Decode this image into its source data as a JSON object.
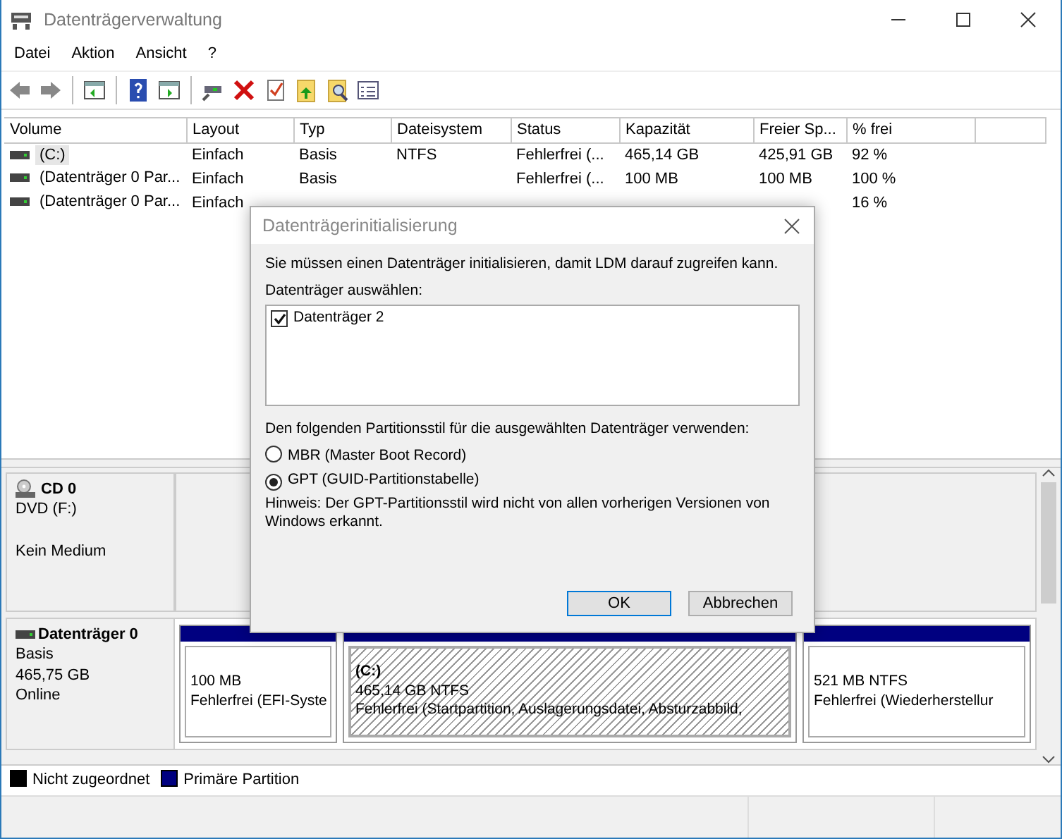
{
  "window": {
    "title": "Datenträgerverwaltung"
  },
  "menu": [
    "Datei",
    "Aktion",
    "Ansicht",
    "?"
  ],
  "volumes_table": {
    "columns": [
      "Volume",
      "Layout",
      "Typ",
      "Dateisystem",
      "Status",
      "Kapazität",
      "Freier Sp...",
      "% frei"
    ],
    "rows": [
      {
        "selected": true,
        "cells": [
          "(C:)",
          "Einfach",
          "Basis",
          "NTFS",
          "Fehlerfrei (...",
          "465,14 GB",
          "425,91 GB",
          "92 %"
        ]
      },
      {
        "selected": false,
        "cells": [
          "(Datenträger 0 Par...",
          "Einfach",
          "Basis",
          null,
          "Fehlerfrei (...",
          "100 MB",
          "100 MB",
          "100 %"
        ]
      },
      {
        "selected": false,
        "cells": [
          "(Datenträger 0 Par...",
          "Einfach",
          null,
          null,
          null,
          null,
          null,
          "16 %"
        ]
      }
    ]
  },
  "disks": [
    {
      "kind": "cd",
      "name": "CD 0",
      "lines": [
        "DVD (F:)",
        "Kein Medium"
      ]
    },
    {
      "kind": "disk",
      "name": "Datenträger 0",
      "lines": [
        "Basis",
        "465,75 GB",
        "Online"
      ],
      "partitions": [
        {
          "selected": false,
          "lines": [
            "100 MB",
            "Fehlerfrei (EFI-Syste"
          ]
        },
        {
          "selected": true,
          "title": "(C:)",
          "lines": [
            "465,14 GB NTFS",
            "Fehlerfrei (Startpartition, Auslagerungsdatei, Absturzabbild,"
          ]
        },
        {
          "selected": false,
          "lines": [
            "521 MB NTFS",
            "Fehlerfrei (Wiederherstellur"
          ]
        }
      ]
    }
  ],
  "legend": [
    {
      "label": "Nicht zugeordnet",
      "color": "#000000"
    },
    {
      "label": "Primäre Partition",
      "color": "#000080"
    }
  ],
  "dialog": {
    "title": "Datenträgerinitialisierung",
    "message": "Sie müssen einen Datenträger initialisieren, damit LDM darauf zugreifen kann.",
    "select_label": "Datenträger auswählen:",
    "disks": [
      {
        "label": "Datenträger 2",
        "checked": true
      }
    ],
    "style_label": "Den folgenden Partitionsstil für die ausgewählten Datenträger verwenden:",
    "options": [
      {
        "label": "MBR (Master Boot Record)",
        "selected": false
      },
      {
        "label": "GPT (GUID-Partitionstabelle)",
        "selected": true
      }
    ],
    "note": "Hinweis: Der GPT-Partitionsstil wird nicht von allen vorherigen Versionen von Windows erkannt.",
    "buttons": [
      {
        "label": "OK",
        "default": true
      },
      {
        "label": "Abbrechen",
        "default": false
      }
    ]
  }
}
